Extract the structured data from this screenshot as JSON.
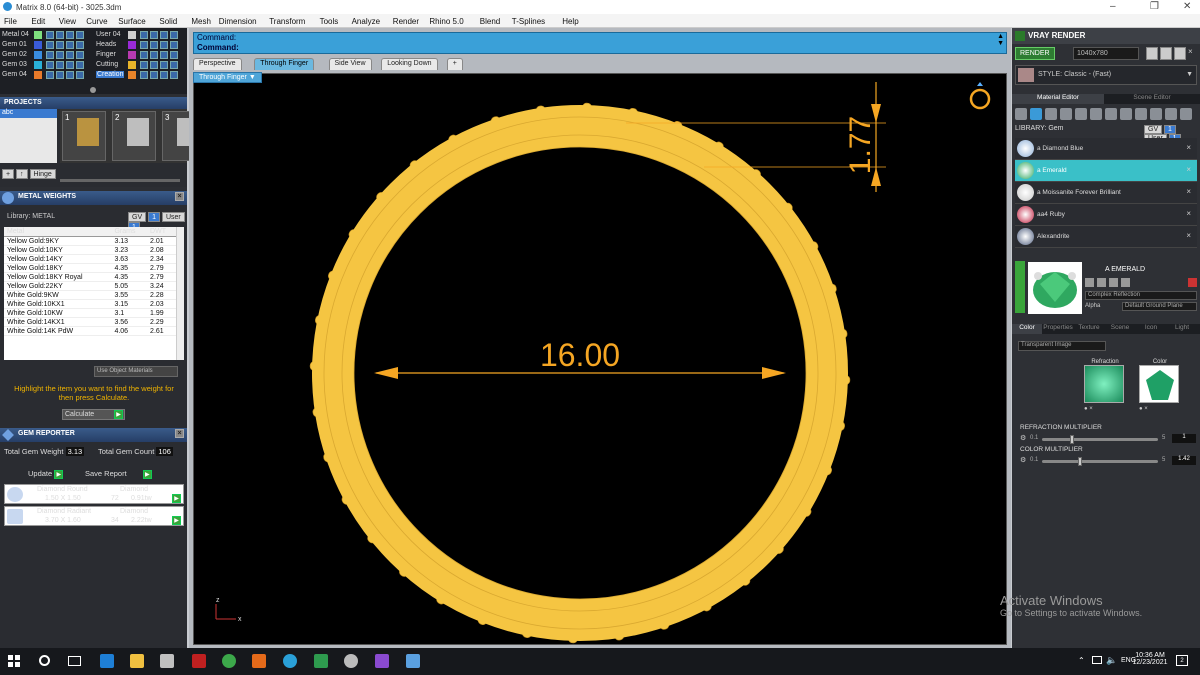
{
  "window": {
    "title": "Matrix 8.0 (64-bit) - 3025.3dm"
  },
  "menu": [
    "File",
    "Edit",
    "View",
    "Curve",
    "Surface",
    "Solid",
    "Mesh",
    "Dimension",
    "Transform",
    "Tools",
    "Analyze",
    "Render",
    "Rhino 5.0",
    "Blend",
    "T-Splines",
    "Help"
  ],
  "layers": {
    "left": [
      {
        "name": "Metal 04",
        "color": "#7fe07f"
      },
      {
        "name": "Gem 01",
        "color": "#3a5bd8"
      },
      {
        "name": "Gem 02",
        "color": "#3a8de0"
      },
      {
        "name": "Gem 03",
        "color": "#2ab0d8"
      },
      {
        "name": "Gem 04",
        "color": "#e87a2a"
      }
    ],
    "right": [
      {
        "name": "User 04",
        "color": "#cfcfcf"
      },
      {
        "name": "Heads",
        "color": "#9a2ad8"
      },
      {
        "name": "Finger",
        "color": "#b83ab0"
      },
      {
        "name": "Cutting",
        "color": "#e8b42a"
      },
      {
        "name": "Creation",
        "color": "#e8842a"
      }
    ]
  },
  "projects": {
    "title": "PROJECTS",
    "item": "abc",
    "thumbs": [
      "1",
      "2",
      "3"
    ],
    "hinge": "Hinge"
  },
  "metal_weights": {
    "title": "METAL WEIGHTS",
    "library": "Library: METAL",
    "gv": "GV",
    "user": "User",
    "columns": [
      "Metal",
      "Grams",
      "DWT"
    ],
    "rows": [
      [
        "Yellow Gold:9KY",
        "3.13",
        "2.01"
      ],
      [
        "Yellow Gold:10KY",
        "3.23",
        "2.08"
      ],
      [
        "Yellow Gold:14KY",
        "3.63",
        "2.34"
      ],
      [
        "Yellow Gold:18KY",
        "4.35",
        "2.79"
      ],
      [
        "Yellow Gold:18KY Royal",
        "4.35",
        "2.79"
      ],
      [
        "Yellow Gold:22KY",
        "5.05",
        "3.24"
      ],
      [
        "White Gold:9KW",
        "3.55",
        "2.28"
      ],
      [
        "White Gold:10KX1",
        "3.15",
        "2.03"
      ],
      [
        "White Gold:10KW",
        "3.1",
        "1.99"
      ],
      [
        "White Gold:14KX1",
        "3.56",
        "2.29"
      ],
      [
        "White Gold:14K PdW",
        "4.06",
        "2.61"
      ]
    ],
    "use_object_materials": "Use Object Materials",
    "hint": "Highlight the item you want to find the weight for then press Calculate.",
    "calculate": "Calculate"
  },
  "gem_reporter": {
    "title": "GEM REPORTER",
    "total_weight_label": "Total Gem Weight",
    "total_weight": "3.13",
    "total_count_label": "Total Gem Count",
    "total_count": "106",
    "update": "Update",
    "save_report": "Save Report",
    "gems": [
      {
        "shape": "Diamond Round",
        "size": "1.50 X 1.50",
        "type": "Diamond",
        "count": "72",
        "weight": "0.91tw"
      },
      {
        "shape": "Diamond Radiant",
        "size": "3.70 X 1.60",
        "type": "Diamond",
        "count": "34",
        "weight": "2.22tw"
      }
    ]
  },
  "command": {
    "line1": "Command:",
    "line2": "Command:"
  },
  "viewport_tabs": [
    "Perspective",
    "Through Finger",
    "Side View",
    "Looking Down",
    "+"
  ],
  "active_tab": "Through Finger",
  "viewport_label": "Through Finger",
  "dimensions": {
    "diameter": "16.00",
    "thickness": "1.77"
  },
  "ring": {
    "prongs": 36,
    "gold": "#f5c542",
    "pave": "#7fb0ff"
  },
  "axis": {
    "z": "z",
    "x": "x"
  },
  "vray": {
    "title": "VRAY RENDER",
    "render": "RENDER",
    "resolution": "1040x780",
    "style": "STYLE: Classic - (Fast)",
    "tabs": [
      "Material Editor",
      "Scene Editor"
    ],
    "library": "LIBRARY: Gem",
    "materials": [
      {
        "name": "a Diamond Blue",
        "color": "#8fb0d8"
      },
      {
        "name": "a Emerald",
        "color": "#2fa860"
      },
      {
        "name": "a Moissanite Forever Brilliant",
        "color": "#c8c8c8"
      },
      {
        "name": "aa4 Ruby",
        "color": "#c02040"
      },
      {
        "name": "Alexandrite",
        "color": "#506080"
      }
    ],
    "selected": "A EMERALD",
    "reflection": "Complex Reflection",
    "alpha": "Alpha",
    "ground": "Default Ground Plane",
    "subtabs": [
      "Color",
      "Properties",
      "Texture",
      "Scene",
      "Icon",
      "Light"
    ],
    "transparent": "Transparent Image",
    "refraction_label": "Refraction",
    "color_label": "Color",
    "refraction_multiplier": {
      "label": "REFRACTION MULTIPLIER",
      "min": "0.1",
      "max": "5",
      "value": "1"
    },
    "color_multiplier": {
      "label": "COLOR MULTIPLIER",
      "min": "0.1",
      "max": "5",
      "value": "1.42"
    }
  },
  "watermark": {
    "line1": "Activate Windows",
    "line2": "Go to Settings to activate Windows."
  },
  "taskbar": {
    "lang": "ENG",
    "time": "10:36 AM",
    "date": "12/23/2021",
    "notif": "2"
  }
}
